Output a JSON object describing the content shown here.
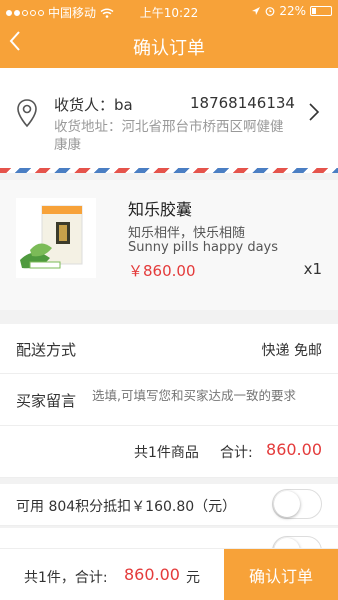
{
  "status_bar": {
    "carrier": "中国移动",
    "time": "上午10:22",
    "battery": "22%"
  },
  "nav": {
    "title": "确认订单",
    "back_icon": "chevron-left-icon"
  },
  "address": {
    "name_label": "收货人：ba",
    "phone": "18768146134",
    "address_text": "收货地址：河北省邢台市桥西区啊健健康康"
  },
  "product": {
    "name": "知乐胶囊",
    "desc1": "知乐相伴，快乐相随",
    "desc2": "Sunny pills happy days",
    "price": "￥860.00",
    "quantity": "x1"
  },
  "shipping": {
    "label": "配送方式",
    "value": "快递 免邮"
  },
  "message": {
    "label": "买家留言",
    "placeholder": "选填,可填写您和买家达成一致的要求"
  },
  "summary": {
    "count": "共1件商品",
    "total_label": "合计:",
    "total": "860.00"
  },
  "points": {
    "label": "可用 804积分抵扣￥160.80（元）",
    "enabled": false
  },
  "footer": {
    "count": "共1件，合计:",
    "amount": "860.00",
    "unit": "元",
    "confirm": "确认订单"
  },
  "colors": {
    "accent": "#f7a239",
    "price": "#e43b3b"
  }
}
